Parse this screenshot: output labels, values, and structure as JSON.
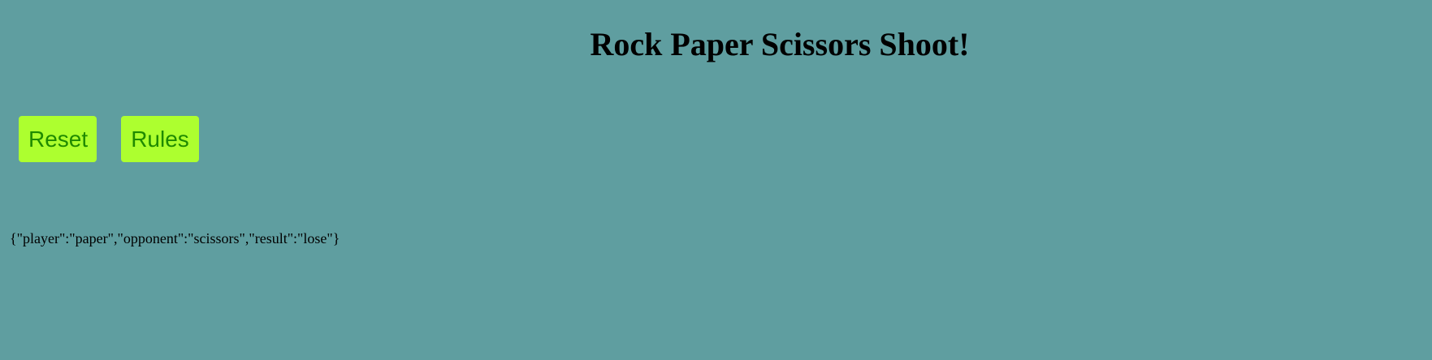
{
  "page": {
    "title": "Rock Paper Scissors Shoot!"
  },
  "controls": {
    "reset_label": "Reset",
    "rules_label": "Rules"
  },
  "result": {
    "text": "{\"player\":\"paper\",\"opponent\":\"scissors\",\"result\":\"lose\"}"
  },
  "colors": {
    "background": "#5f9ea0",
    "button_background": "#adff2f",
    "button_text": "#1f8a00",
    "text": "#000000"
  }
}
